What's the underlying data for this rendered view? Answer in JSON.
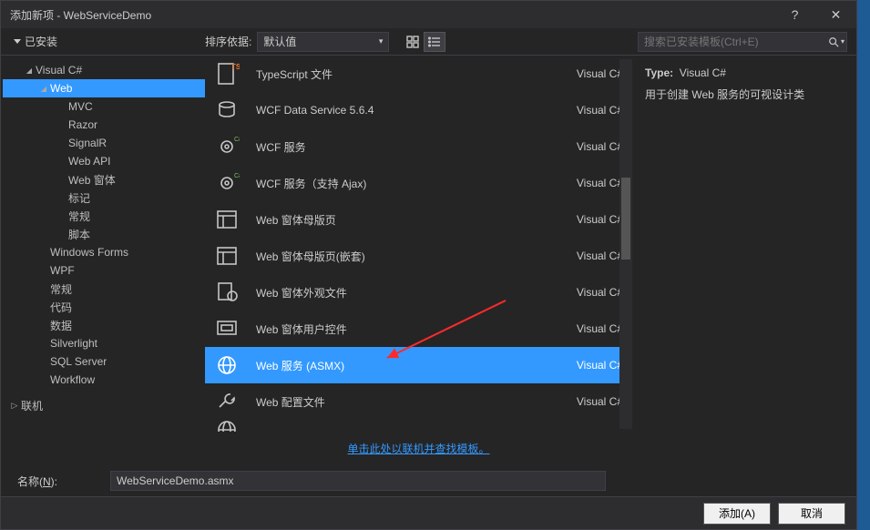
{
  "window": {
    "title": "添加新项 - WebServiceDemo",
    "help": "?",
    "close": "✕"
  },
  "topbar": {
    "installed": "已安装",
    "sort_label": "排序依据:",
    "sort_value": "默认值",
    "search_placeholder": "搜索已安装模板(Ctrl+E)"
  },
  "tree": {
    "items": [
      {
        "label": "Visual C#",
        "indent": 1,
        "caret": true
      },
      {
        "label": "Web",
        "indent": 2,
        "caret": true,
        "selected": true
      },
      {
        "label": "MVC",
        "indent": 3
      },
      {
        "label": "Razor",
        "indent": 3
      },
      {
        "label": "SignalR",
        "indent": 3
      },
      {
        "label": "Web API",
        "indent": 3
      },
      {
        "label": "Web 窗体",
        "indent": 3
      },
      {
        "label": "标记",
        "indent": 3
      },
      {
        "label": "常规",
        "indent": 3
      },
      {
        "label": "脚本",
        "indent": 3
      },
      {
        "label": "Windows Forms",
        "indent": 2
      },
      {
        "label": "WPF",
        "indent": 2
      },
      {
        "label": "常规",
        "indent": 2
      },
      {
        "label": "代码",
        "indent": 2
      },
      {
        "label": "数据",
        "indent": 2
      },
      {
        "label": "Silverlight",
        "indent": 2
      },
      {
        "label": "SQL Server",
        "indent": 2
      },
      {
        "label": "Workflow",
        "indent": 2
      }
    ],
    "online": "联机"
  },
  "list": {
    "items": [
      {
        "name": "TypeScript 文件",
        "lang": "Visual C#",
        "icon": "file-ts"
      },
      {
        "name": "WCF Data Service 5.6.4",
        "lang": "Visual C#",
        "icon": "wcf-data"
      },
      {
        "name": "WCF 服务",
        "lang": "Visual C#",
        "icon": "gear-cs"
      },
      {
        "name": "WCF 服务（支持 Ajax)",
        "lang": "Visual C#",
        "icon": "gear-cs"
      },
      {
        "name": "Web 窗体母版页",
        "lang": "Visual C#",
        "icon": "master"
      },
      {
        "name": "Web 窗体母版页(嵌套)",
        "lang": "Visual C#",
        "icon": "master"
      },
      {
        "name": "Web 窗体外观文件",
        "lang": "Visual C#",
        "icon": "skin"
      },
      {
        "name": "Web 窗体用户控件",
        "lang": "Visual C#",
        "icon": "control"
      },
      {
        "name": "Web 服务 (ASMX)",
        "lang": "Visual C#",
        "icon": "globe",
        "selected": true
      },
      {
        "name": "Web 配置文件",
        "lang": "Visual C#",
        "icon": "wrench"
      }
    ],
    "online_link": "单击此处以联机并查找模板。"
  },
  "detail": {
    "type_label": "Type:",
    "type_value": "Visual C#",
    "desc": "用于创建 Web 服务的可视设计类"
  },
  "name": {
    "label_prefix": "名称(",
    "label_key": "N",
    "label_suffix": "):",
    "value": "WebServiceDemo.asmx"
  },
  "buttons": {
    "add": "添加(A)",
    "cancel": "取消"
  }
}
